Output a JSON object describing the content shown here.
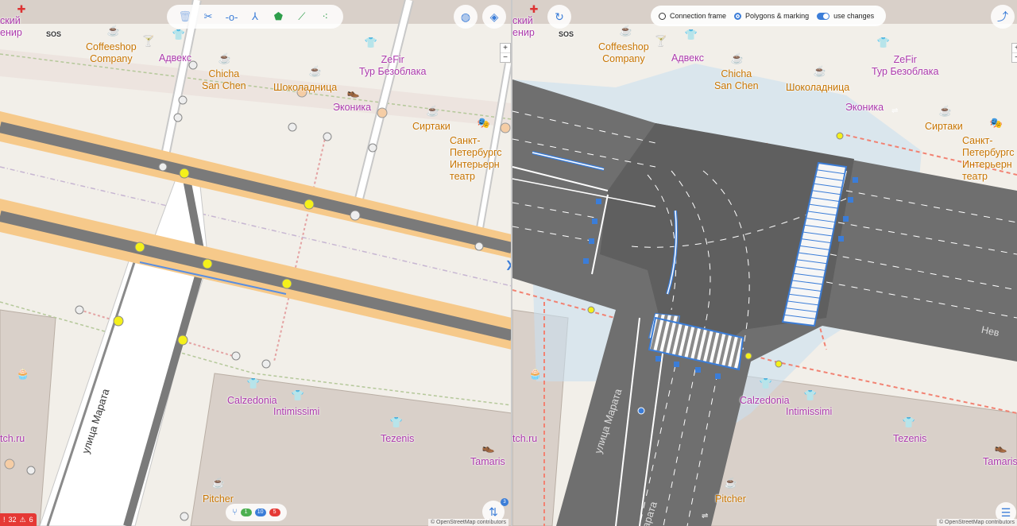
{
  "left": {
    "labels": {
      "coffeeshop": "Coffeeshop\nCompany",
      "advex": "Адвекс",
      "chicha": "Chicha\nSan Chen",
      "shokoladnica": "Шоколадница",
      "zefir": "ZeFir\nТур Безоблака",
      "ekonika": "Эконика",
      "sirtaki": "Сиртаки",
      "teatr": "Санкт-\nПетербургс\nИнтерьерн\nтеатр",
      "calzedonia": "Calzedonia",
      "intimissimi": "Intimissimi",
      "tezenis": "Tezenis",
      "tamaris": "Tamaris",
      "pitcher": "Pitcher",
      "edge_top": "ский\nенир",
      "sos": "SOS",
      "tch": "tch.ru",
      "street": "улица Марата"
    },
    "toolbar": {
      "delete": "delete-icon",
      "split": "scissors-icon",
      "node": "node-icon",
      "branch": "branch-icon",
      "polygon": "polygon-icon",
      "line": "line-icon",
      "points": "points-icon"
    },
    "zoom": {
      "in": "+",
      "out": "−"
    },
    "status": {
      "errors": "32",
      "warnings": "6"
    },
    "counts": {
      "green": "1",
      "blue": "10",
      "red": "5"
    },
    "attribution": "© OpenStreetMap contributors",
    "badge": "3"
  },
  "right": {
    "options": {
      "connection_frame": "Connection frame",
      "polygons_marking": "Polygons & marking",
      "use_changes": "use changes"
    },
    "labels": {
      "coffeeshop": "Coffeeshop\nCompany",
      "advex": "Адвекс",
      "chicha": "Chicha\nSan Chen",
      "shokoladnica": "Шоколадница",
      "zefir": "ZeFir\nТур Безоблака",
      "ekonika": "Эконика",
      "sirtaki": "Сиртаки",
      "teatr": "Санкт-\nПетербургс\nИнтерьерн\nтеатр",
      "calzedonia": "Calzedonia",
      "intimissimi": "Intimissimi",
      "tezenis": "Tezenis",
      "tamaris": "Tamaris",
      "pitcher": "Pitcher",
      "edge_top": "ский\nенир",
      "sos": "SOS",
      "tch": "tch.ru",
      "street": "улица Марата",
      "street2": "арата",
      "nevsky": "Нев"
    },
    "zoom": {
      "in": "+",
      "out": "−"
    },
    "attribution": "© OpenStreetMap contributors"
  },
  "colors": {
    "road_dark": "#6e6e6e",
    "road_casing": "#f6c98a",
    "selection": "#3b7dd8",
    "vertex": "#f4f01b",
    "shop": "#ac39ac",
    "food": "#c77400",
    "building": "#d9d0c9",
    "footway": "#f28272"
  }
}
